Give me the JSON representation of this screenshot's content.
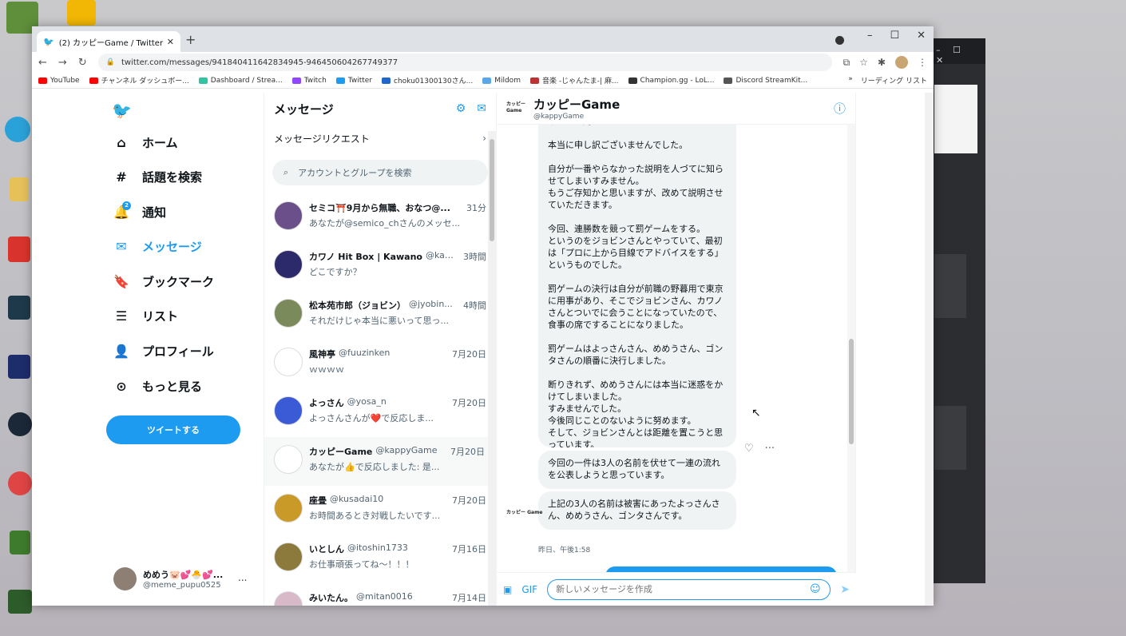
{
  "desktop": {
    "icons": [
      "Minecraft Launcher",
      "Microsoft Edge",
      "Steam",
      "Grand Theft Auto V"
    ]
  },
  "browser": {
    "tab_title": "(2) カッピーGame / Twitter",
    "url": "twitter.com/messages/941840411642834945-946450604267749377",
    "bookmarks": [
      "YouTube",
      "チャンネル ダッシュボー...",
      "Dashboard / Strea...",
      "Twitch",
      "Twitter",
      "choku01300130さん...",
      "Mildom",
      "音楽 -じゃんたま-| 麻...",
      "Champion.gg - LoL...",
      "Discord StreamKit..."
    ],
    "reading_list": "リーディング リスト",
    "bookmarks_more": "»"
  },
  "nav": {
    "home": "ホーム",
    "explore": "話題を検索",
    "notifications": "通知",
    "notifications_badge": "2",
    "messages": "メッセージ",
    "bookmarks": "ブックマーク",
    "lists": "リスト",
    "profile": "プロフィール",
    "more": "もっと見る",
    "tweet_button": "ツイートする",
    "user_name": "めめう🐷💕🐣💕...",
    "user_handle": "@meme_pupu0525",
    "user_more": "..."
  },
  "messages": {
    "title": "メッセージ",
    "requests": "メッセージリクエスト",
    "search_placeholder": "アカウントとグループを検索",
    "conversations": [
      {
        "name": "セミコ⛩️9月から無職、おなつ@...",
        "handle": "",
        "time": "31分",
        "preview": "あなたが@semico_chさんのメッセ...",
        "color": "#6a4f8a"
      },
      {
        "name": "カワノ Hit Box | Kawano",
        "handle": "@kawa...",
        "time": "3時間",
        "preview": "どこですか？",
        "color": "#2c2a6b"
      },
      {
        "name": "松本苑市郎（ジョビン）",
        "handle": "@jyobin...",
        "time": "4時間",
        "preview": "それだけじゃ本当に悪いって思っ...",
        "color": "#7a8a5a"
      },
      {
        "name": "風神亭",
        "handle": "@fuuzinken",
        "time": "7月20日",
        "preview": "ｗｗｗｗ",
        "color": "#ffffff"
      },
      {
        "name": "よっさん",
        "handle": "@yosa_n",
        "time": "7月20日",
        "preview": "よっさんさんが❤️で反応しま...",
        "color": "#3b5bd6"
      },
      {
        "name": "カッピーGame",
        "handle": "@kappyGame",
        "time": "7月20日",
        "preview": "あなたが👍で反応しました: 是...",
        "color": "#ffffff"
      },
      {
        "name": "座畳",
        "handle": "@kusadai10",
        "time": "7月20日",
        "preview": "お時間あるとき対戦したいです...",
        "color": "#c99a28"
      },
      {
        "name": "いとしん",
        "handle": "@itoshin1733",
        "time": "7月16日",
        "preview": "お仕事頑張ってね～！！！",
        "color": "#8c7a3c"
      },
      {
        "name": "みいたん。",
        "handle": "@mitan0016",
        "time": "7月14日",
        "preview": "",
        "color": "#d7b9c8"
      }
    ]
  },
  "chat": {
    "name": "カッピーGame",
    "handle": "@kappyGame",
    "logo_text": "カッピー Game",
    "big_message": "改めてお詫びさせてください。\n\n本当に申し訳ございませんでした。\n\n自分が一番やらなかった説明を人づてに知らせてしまいすみません。\nもうご存知かと思いますが、改めて説明させていただきます。\n\n今回、連勝数を競って罰ゲームをする。\nというのをジョビンさんとやっていて、最初は「プロに上から目線でアドバイスをする」というものでした。\n\n罰ゲームの決行は自分が前職の野暮用で東京に用事があり、そこでジョビンさん、カワノさんとついでに会うことになっていたので、食事の席ですることになりました。\n\n罰ゲームはよっさんさん、めめうさん、ゴンタさんの順番に決行しました。\n\n断りきれず、めめうさんには本当に迷惑をかけてしまいました。\nすみませんでした。\n今後同じことのないように努めます。\nそして、ジョビンさんとは距離を置こうと思っています。",
    "message2": "今回の一件は3人の名前を伏せて一連の流れを公表しようと思っています。",
    "message3": "上記の3人の名前は被害にあったよっさんさん、めめうさん、ゴンタさんです。",
    "timestamp": "昨日、午後1:58",
    "composer_placeholder": "新しいメッセージを作成"
  },
  "colors": {
    "accent": "#1d9bf0",
    "bubble": "#eff3f4",
    "muted": "#536471"
  }
}
